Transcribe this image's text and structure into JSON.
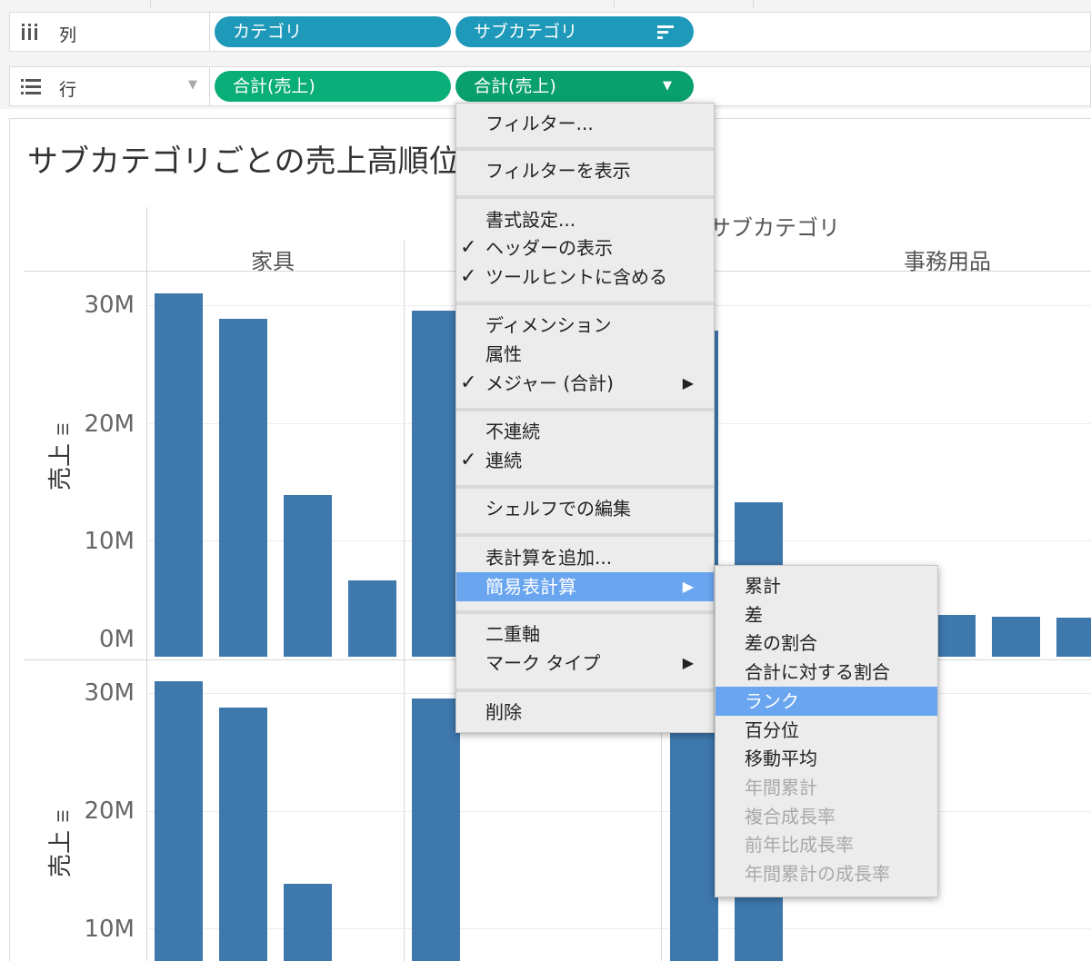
{
  "columns_shelf": {
    "label": "列",
    "pills": [
      "カテゴリ",
      "サブカテゴリ"
    ]
  },
  "rows_shelf": {
    "label": "行",
    "pills": [
      "合計(売上)",
      "合計(売上)"
    ]
  },
  "view": {
    "title": "サブカテゴリごとの売上高順位",
    "column_header_title": "サブカテゴリ",
    "categories": [
      "家具",
      "事務用品"
    ],
    "y_axis_title": "売上",
    "top_ticks": [
      "30M",
      "20M",
      "10M",
      "0M"
    ],
    "bottom_ticks": [
      "30M",
      "20M",
      "10M"
    ]
  },
  "chart_data": {
    "type": "bar",
    "ylabel": "売上",
    "ylim": [
      0,
      33000000
    ],
    "series": [
      {
        "name": "家具",
        "values": [
          31000000,
          28800000,
          13800000,
          6500000
        ]
      },
      {
        "name": "",
        "values": [
          29500000
        ]
      },
      {
        "name": "",
        "values": [
          27800000,
          13200000
        ]
      },
      {
        "name": "事務用品",
        "values": [
          3600000,
          3400000,
          3300000
        ]
      }
    ]
  },
  "context_menu": {
    "items": [
      {
        "label": "フィルター...",
        "checked": false,
        "submenu": false
      },
      {
        "label": "フィルターを表示",
        "checked": false,
        "submenu": false
      },
      {
        "label": "書式設定...",
        "checked": false,
        "submenu": false
      },
      {
        "label": "ヘッダーの表示",
        "checked": true,
        "submenu": false
      },
      {
        "label": "ツールヒントに含める",
        "checked": true,
        "submenu": false
      },
      {
        "label": "ディメンション",
        "checked": false,
        "submenu": false
      },
      {
        "label": "属性",
        "checked": false,
        "submenu": false
      },
      {
        "label": "メジャー (合計)",
        "checked": true,
        "submenu": true
      },
      {
        "label": "不連続",
        "checked": false,
        "submenu": false
      },
      {
        "label": "連続",
        "checked": true,
        "submenu": false
      },
      {
        "label": "シェルフでの編集",
        "checked": false,
        "submenu": false
      },
      {
        "label": "表計算を追加...",
        "checked": false,
        "submenu": false
      },
      {
        "label": "簡易表計算",
        "checked": false,
        "submenu": true,
        "selected": true
      },
      {
        "label": "二重軸",
        "checked": false,
        "submenu": false
      },
      {
        "label": "マーク タイプ",
        "checked": false,
        "submenu": true
      },
      {
        "label": "削除",
        "checked": false,
        "submenu": false
      }
    ]
  },
  "quick_calc_menu": {
    "items": [
      {
        "label": "累計",
        "enabled": true
      },
      {
        "label": "差",
        "enabled": true
      },
      {
        "label": "差の割合",
        "enabled": true
      },
      {
        "label": "合計に対する割合",
        "enabled": true
      },
      {
        "label": "ランク",
        "enabled": true,
        "selected": true
      },
      {
        "label": "百分位",
        "enabled": true
      },
      {
        "label": "移動平均",
        "enabled": true
      },
      {
        "label": "年間累計",
        "enabled": false
      },
      {
        "label": "複合成長率",
        "enabled": false
      },
      {
        "label": "前年比成長率",
        "enabled": false
      },
      {
        "label": "年間累計の成長率",
        "enabled": false
      }
    ]
  },
  "colors": {
    "bar": "#3e78ad",
    "pill_blue": "#1f99b9",
    "pill_green": "#0aae78",
    "menu_highlight": "#6aa5f0"
  },
  "icons": [
    "columns-icon",
    "rows-icon",
    "sort-icon",
    "dropdown-icon",
    "sort-indicator-icon",
    "checkmark-icon",
    "submenu-arrow-icon"
  ]
}
